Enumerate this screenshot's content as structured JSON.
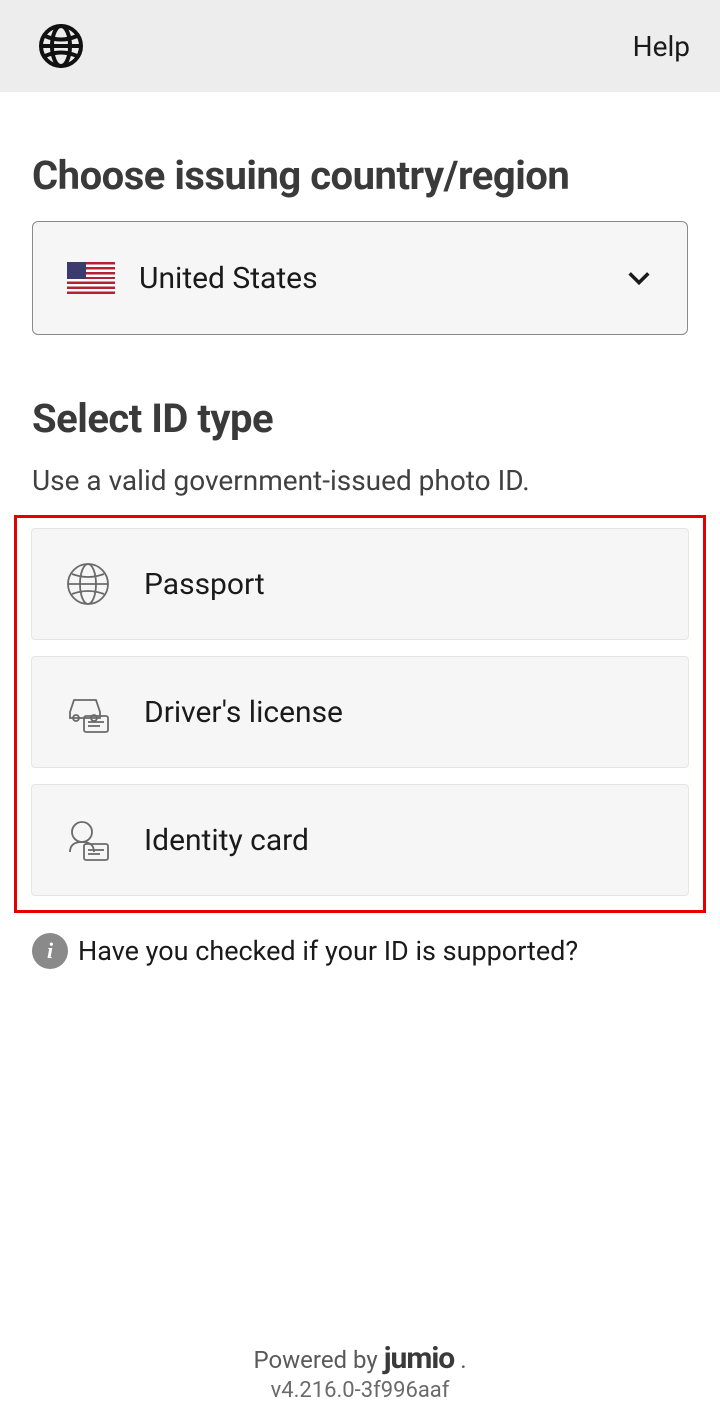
{
  "header": {
    "help_label": "Help"
  },
  "country_section": {
    "title": "Choose issuing country/region",
    "selected_country": "United States"
  },
  "id_section": {
    "title": "Select ID type",
    "subtitle": "Use a valid government-issued photo ID.",
    "options": [
      {
        "label": "Passport"
      },
      {
        "label": "Driver's license"
      },
      {
        "label": "Identity card"
      }
    ]
  },
  "info": {
    "text": "Have you checked if your ID is supported?"
  },
  "footer": {
    "powered_prefix": "Powered by",
    "brand": "jumio",
    "version": "v4.216.0-3f996aaf"
  }
}
